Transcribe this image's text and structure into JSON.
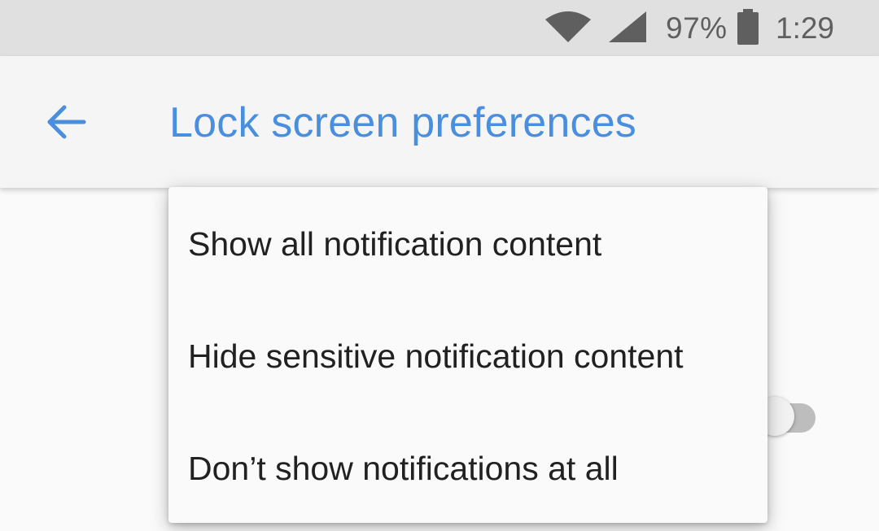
{
  "status_bar": {
    "wifi_icon": "wifi-icon",
    "signal_icon": "cell-signal-icon",
    "battery_percent": "97%",
    "battery_icon": "battery-icon",
    "time": "1:29",
    "text_color": "#5f5f5f",
    "background": "#e0e0e0"
  },
  "app_bar": {
    "back_icon": "arrow-back-icon",
    "title": "Lock screen preferences",
    "accent_color": "#4a8ee0",
    "background": "#f5f5f5"
  },
  "popup_menu": {
    "options": [
      {
        "label": "Show all notification content"
      },
      {
        "label": "Hide sensitive notification content"
      },
      {
        "label": "Don’t show notifications at all"
      }
    ],
    "text_color": "#212121"
  },
  "background_content": {
    "toggle": {
      "state": "off",
      "icon": "toggle-switch"
    }
  }
}
